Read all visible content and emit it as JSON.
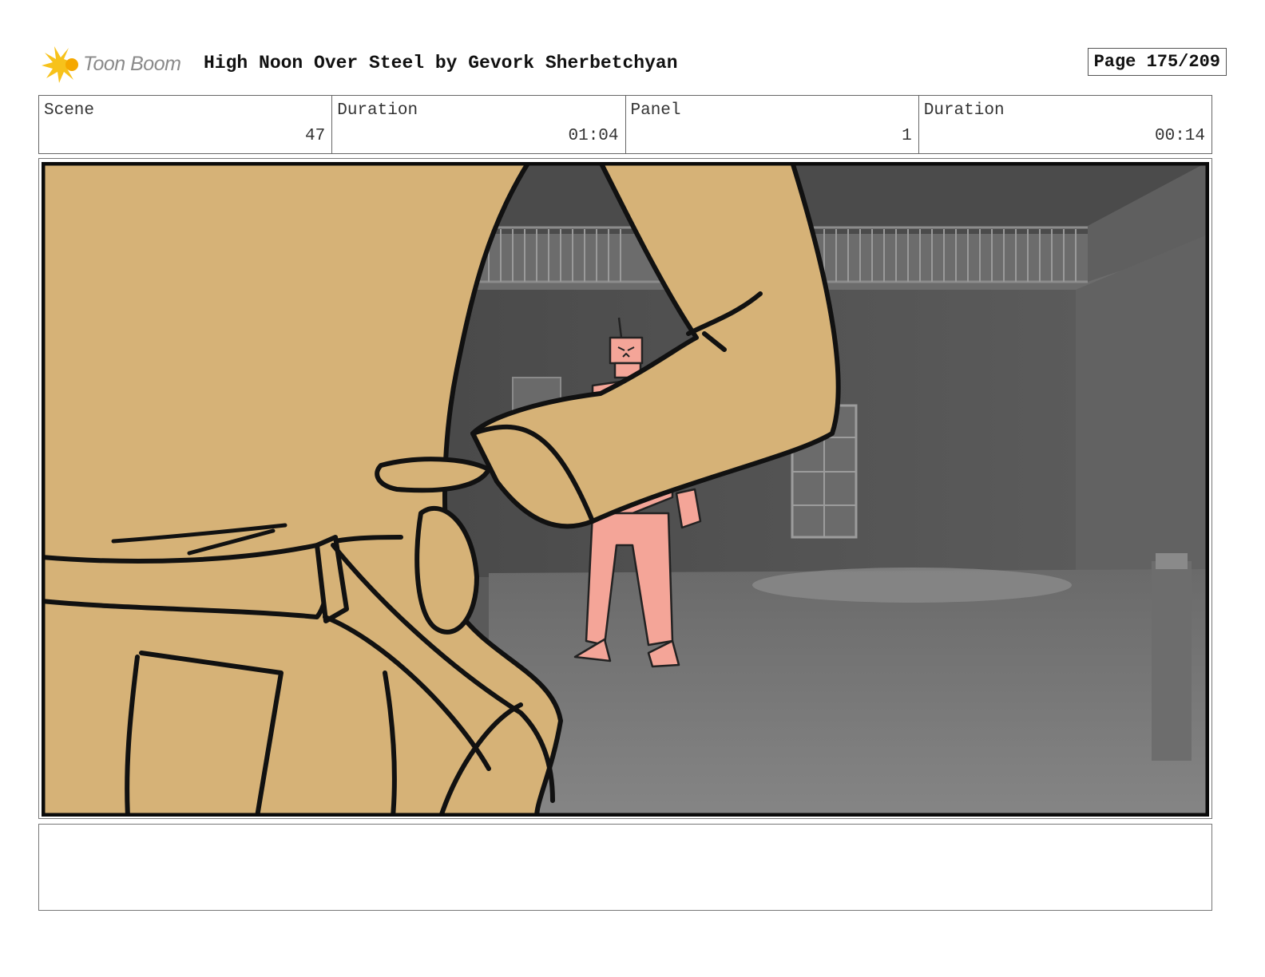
{
  "header": {
    "logo_text": "Toon Boom",
    "title": "High Noon Over Steel by Gevork Sherbetchyan",
    "page": "Page 175/209"
  },
  "info": {
    "scene_label": "Scene",
    "scene_value": "47",
    "scene_duration_label": "Duration",
    "scene_duration_value": "01:04",
    "panel_label": "Panel",
    "panel_value": "1",
    "panel_duration_label": "Duration",
    "panel_duration_value": "00:14"
  },
  "colors": {
    "coat": "#d6b277",
    "robot": "#f4a598",
    "room_dark": "#4a4a4a",
    "floor": "#7d7d7d"
  },
  "notes": ""
}
